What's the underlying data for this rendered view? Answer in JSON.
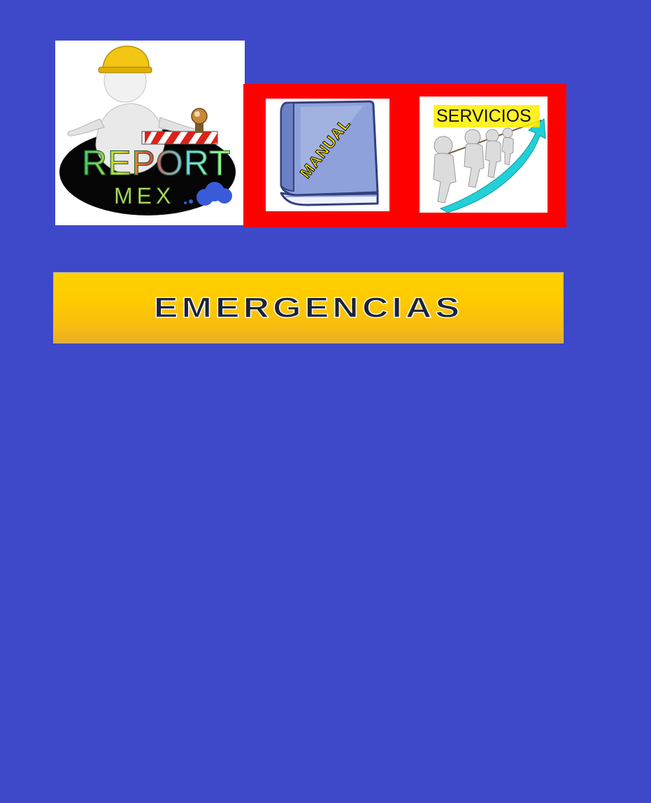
{
  "logo": {
    "line1": "REPORT",
    "line2": "MEX",
    "icon": "construction-worker-barrier-logo"
  },
  "nav": {
    "panel_color": "#ff0000",
    "manual": {
      "label": "MANUAL",
      "icon": "book-icon"
    },
    "servicios": {
      "label": "SERVICIOS",
      "icon": "team-pulling-arrow-icon"
    }
  },
  "emergency": {
    "label": "EMERGENCIAS",
    "color": "#ffcb00"
  },
  "page": {
    "background": "#3e49c9"
  }
}
